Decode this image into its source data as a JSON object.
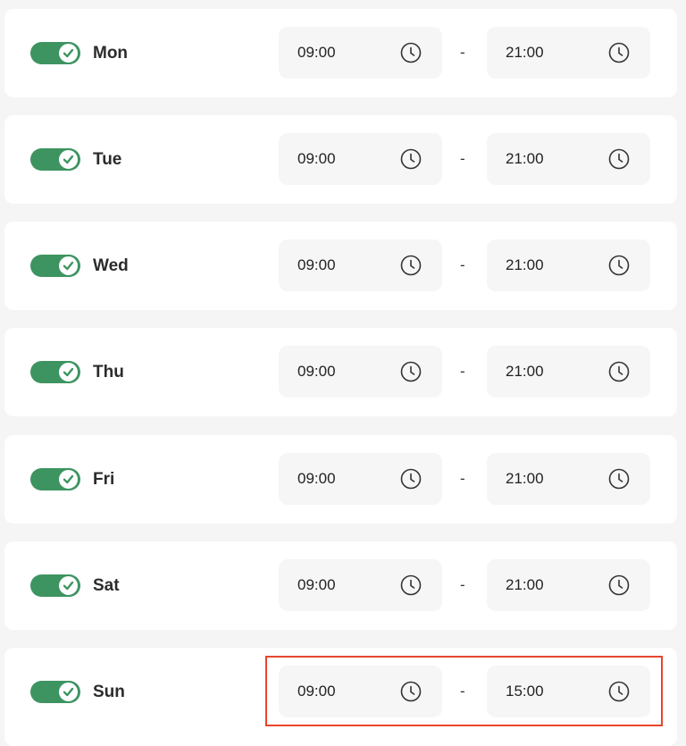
{
  "accent_color": "#3d9460",
  "highlight_color": "#e8452c",
  "schedule": [
    {
      "day": "Mon",
      "enabled": true,
      "start": "09:00",
      "end": "21:00"
    },
    {
      "day": "Tue",
      "enabled": true,
      "start": "09:00",
      "end": "21:00"
    },
    {
      "day": "Wed",
      "enabled": true,
      "start": "09:00",
      "end": "21:00"
    },
    {
      "day": "Thu",
      "enabled": true,
      "start": "09:00",
      "end": "21:00"
    },
    {
      "day": "Fri",
      "enabled": true,
      "start": "09:00",
      "end": "21:00"
    },
    {
      "day": "Sat",
      "enabled": true,
      "start": "09:00",
      "end": "21:00"
    },
    {
      "day": "Sun",
      "enabled": true,
      "start": "09:00",
      "end": "15:00"
    }
  ],
  "separator": "-",
  "icons": {
    "toggle": "check-icon",
    "time": "clock-icon"
  }
}
